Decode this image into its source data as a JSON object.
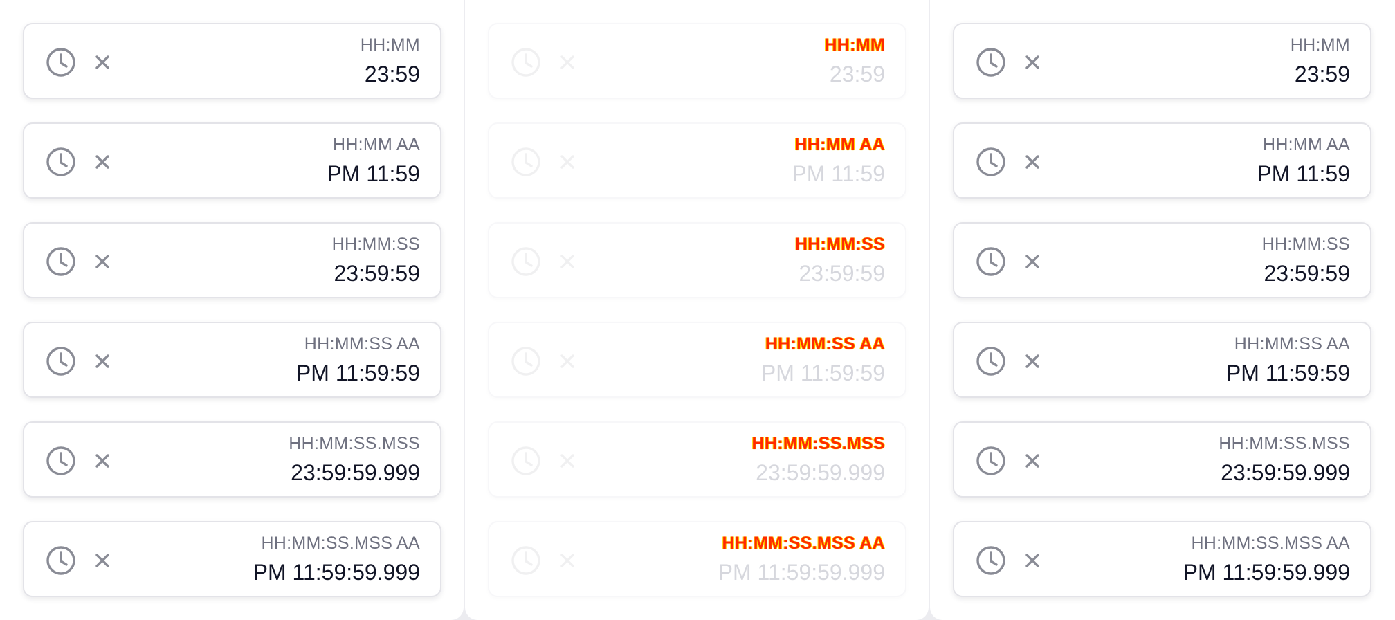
{
  "colors": {
    "icon_gray": "#8a8c96",
    "value_text": "#111426",
    "format_text": "#6f7180",
    "glitch_red": "#ff2a00",
    "glitch_yellow": "#ffd200"
  },
  "icons": {
    "clock": "clock-icon",
    "clear": "close-icon"
  },
  "columns": [
    {
      "state": "enabled",
      "fields": [
        {
          "format": "HH:MM",
          "value": "23:59"
        },
        {
          "format": "HH:MM AA",
          "value": "PM 11:59"
        },
        {
          "format": "HH:MM:SS",
          "value": "23:59:59"
        },
        {
          "format": "HH:MM:SS AA",
          "value": "PM 11:59:59"
        },
        {
          "format": "HH:MM:SS.MSS",
          "value": "23:59:59.999"
        },
        {
          "format": "HH:MM:SS.MSS AA",
          "value": "PM 11:59:59.999"
        }
      ]
    },
    {
      "state": "disabled",
      "fields": [
        {
          "format": "HH:MM",
          "value": "23:59"
        },
        {
          "format": "HH:MM AA",
          "value": "PM 11:59"
        },
        {
          "format": "HH:MM:SS",
          "value": "23:59:59"
        },
        {
          "format": "HH:MM:SS AA",
          "value": "PM 11:59:59"
        },
        {
          "format": "HH:MM:SS.MSS",
          "value": "23:59:59.999"
        },
        {
          "format": "HH:MM:SS.MSS AA",
          "value": "PM 11:59:59.999"
        }
      ]
    },
    {
      "state": "enabled",
      "fields": [
        {
          "format": "HH:MM",
          "value": "23:59"
        },
        {
          "format": "HH:MM AA",
          "value": "PM 11:59"
        },
        {
          "format": "HH:MM:SS",
          "value": "23:59:59"
        },
        {
          "format": "HH:MM:SS AA",
          "value": "PM 11:59:59"
        },
        {
          "format": "HH:MM:SS.MSS",
          "value": "23:59:59.999"
        },
        {
          "format": "HH:MM:SS.MSS AA",
          "value": "PM 11:59:59.999"
        }
      ]
    }
  ]
}
